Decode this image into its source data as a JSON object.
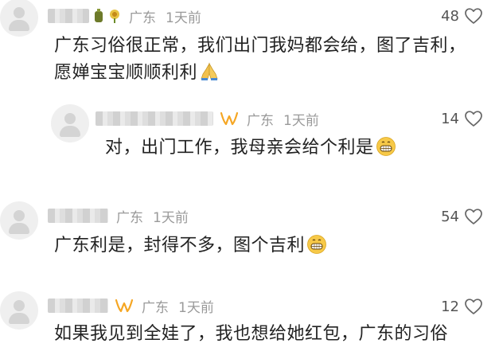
{
  "comments": [
    {
      "location": "广东",
      "time": "1天前",
      "likes": "48",
      "text_line1": "广东习俗很正常，我们出门我妈都会给，图了吉利，",
      "text_line2": "愿婵宝宝顺顺利利",
      "emoji": "🙏"
    },
    {
      "location": "广东",
      "time": "1天前",
      "likes": "14",
      "text": "对，出门工作，我母亲会给个利是",
      "emoji": "😁"
    },
    {
      "location": "广东",
      "time": "1天前",
      "likes": "54",
      "text": "广东利是，封得不多，图个吉利",
      "emoji": "😁"
    },
    {
      "location": "广东",
      "time": "1天前",
      "likes": "12",
      "text": "如果我见到全娃了，我也想给她红包，广东的习俗"
    }
  ],
  "icons": {
    "heart": "heart-outline-icon",
    "badge_w": "w-badge-icon"
  },
  "colors": {
    "meta_gray": "#9a9a9a",
    "text": "#222222",
    "badge_orange": "#f5a623"
  }
}
